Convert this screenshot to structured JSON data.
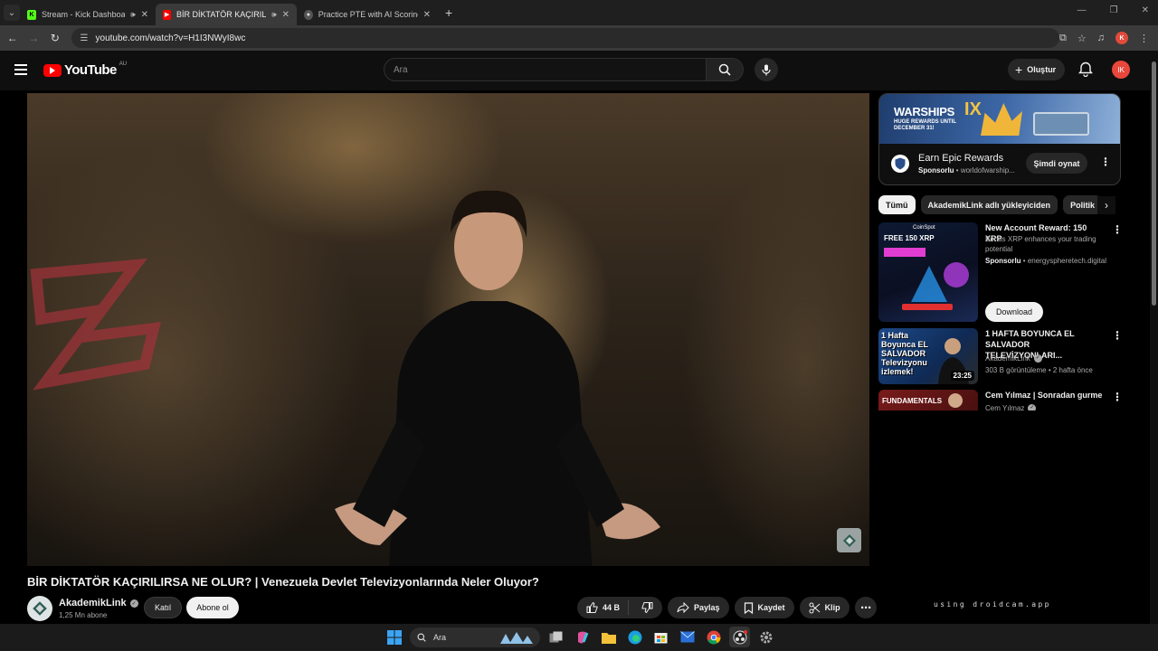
{
  "browser": {
    "tabs": [
      {
        "title": "Stream - Kick Dashboard",
        "favicon": "kick-icon",
        "audio": true,
        "active": false
      },
      {
        "title": "BİR DİKTATÖR KAÇIRILIRSA",
        "favicon": "youtube-icon",
        "audio": true,
        "active": true
      },
      {
        "title": "Practice PTE with AI Scorings -",
        "favicon": "globe-icon",
        "audio": false,
        "active": false
      }
    ],
    "url": "youtube.com/watch?v=H1I3NWyI8wc",
    "profile_initial": "K"
  },
  "youtube": {
    "logo_text": "YouTube",
    "region": "AU",
    "search_placeholder": "Ara",
    "create_label": "Oluştur",
    "user_initials": "IK"
  },
  "video": {
    "title": "BİR DİKTATÖR KAÇIRILIRSA NE OLUR? | Venezuela Devlet Televizyonlarında Neler Oluyor?",
    "channel": "AkademikLink",
    "subscribers": "1,25 Mn abone",
    "join_label": "Katıl",
    "subscribe_label": "Abone ol",
    "likes": "44 B",
    "share_label": "Paylaş",
    "save_label": "Kaydet",
    "clip_label": "Klip"
  },
  "sidebar": {
    "ad": {
      "banner_title": "WARSHIPS",
      "banner_sub": "HUGE REWARDS UNTIL DECEMBER 31!",
      "banner_mark": "IX",
      "title": "Earn Epic Rewards",
      "sponsored": "Sponsorlu",
      "domain": "worldofwarship...",
      "cta": "Şimdi oynat"
    },
    "chips": [
      "Tümü",
      "AkademikLink adlı yükleyiciden",
      "Politik"
    ],
    "recommendations": [
      {
        "title": "New Account Reward: 150 XRP",
        "desc": "Bonus XRP enhances your trading potential",
        "sponsored": "Sponsorlu",
        "domain": "energyspheretech.digital",
        "cta": "Download",
        "thumb_text": "FREE 150 XRP",
        "thumb_brand": "CoinSpot"
      },
      {
        "title": "1 HAFTA BOYUNCA EL SALVADOR TELEVİZYONLARI...",
        "channel": "AkademikLink",
        "meta": "303 B görüntüleme • 2 hafta önce",
        "duration": "23:25",
        "thumb_text": "1 Hafta Boyunca EL SALVADOR Televizyonu izlemek!"
      },
      {
        "title": "Cem Yılmaz | Sonradan gurme",
        "channel": "Cem Yılmaz",
        "thumb_text": "FUNDAMENTALS"
      }
    ]
  },
  "overlay_text": "using droidcam.app",
  "taskbar": {
    "search_placeholder": "Ara"
  }
}
